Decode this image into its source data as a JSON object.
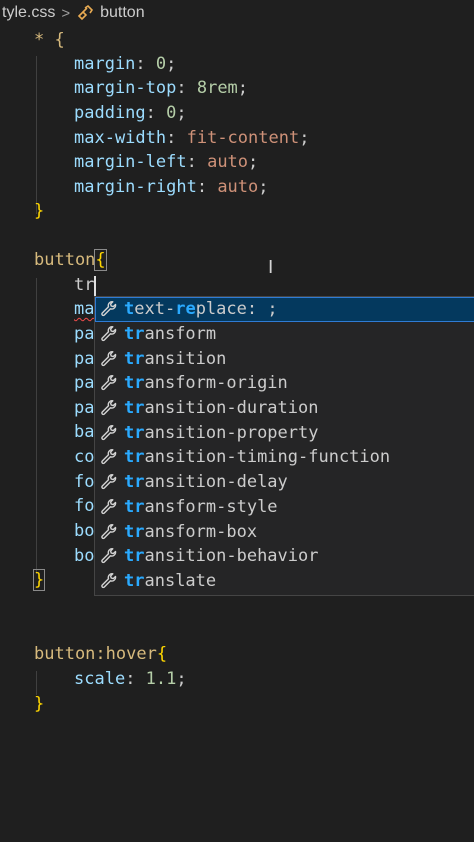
{
  "breadcrumb": {
    "file": "tyle.css",
    "separator": ">",
    "symbol": "button"
  },
  "code": {
    "l1": {
      "sel": "* {"
    },
    "l2": {
      "prop": "margin",
      "colon": ": ",
      "val": "0",
      "semi": ";"
    },
    "l3": {
      "prop": "margin-top",
      "colon": ": ",
      "val": "8rem",
      "semi": ";"
    },
    "l4": {
      "prop": "padding",
      "colon": ": ",
      "val": "0",
      "semi": ";"
    },
    "l5": {
      "prop": "max-width",
      "colon": ": ",
      "val": "fit-content",
      "semi": ";"
    },
    "l6": {
      "prop": "margin-left",
      "colon": ": ",
      "val": "auto",
      "semi": ";"
    },
    "l7": {
      "prop": "margin-right",
      "colon": ": ",
      "val": "auto",
      "semi": ";"
    },
    "l8": {
      "close": "}"
    },
    "l10": {
      "sel": "button",
      "open": "{"
    },
    "l11": {
      "typed": "tr"
    },
    "l12": {
      "frag": "ma"
    },
    "l13": {
      "frag": "pa"
    },
    "l14": {
      "frag": "pa"
    },
    "l15": {
      "frag": "pa"
    },
    "l16": {
      "frag": "pa"
    },
    "l17": {
      "frag": "ba"
    },
    "l18": {
      "frag": "co"
    },
    "l19": {
      "frag": "fo"
    },
    "l20": {
      "frag": "fo"
    },
    "l21": {
      "frag": "bo"
    },
    "l22": {
      "frag": "bo"
    },
    "l23": {
      "close": "}"
    },
    "l26": {
      "sel": "button:hover",
      "open": "{"
    },
    "l27": {
      "prop": "scale",
      "colon": ": ",
      "val": "1.1",
      "semi": ";"
    },
    "l28": {
      "close": "}"
    }
  },
  "suggestions": [
    {
      "match": "t",
      "gap": "ext-",
      "match2": "re",
      "rest": "place: ;"
    },
    {
      "match": "tr",
      "rest": "ansform"
    },
    {
      "match": "tr",
      "rest": "ansition"
    },
    {
      "match": "tr",
      "rest": "ansform-origin"
    },
    {
      "match": "tr",
      "rest": "ansition-duration"
    },
    {
      "match": "tr",
      "rest": "ansition-property"
    },
    {
      "match": "tr",
      "rest": "ansition-timing-function"
    },
    {
      "match": "tr",
      "rest": "ansition-delay"
    },
    {
      "match": "tr",
      "rest": "ansform-style"
    },
    {
      "match": "tr",
      "rest": "ansform-box"
    },
    {
      "match": "tr",
      "rest": "ansition-behavior"
    },
    {
      "match": "tr",
      "rest": "anslate"
    }
  ],
  "colors": {
    "background": "#1f1f1f",
    "accent": "#2aaaff",
    "selection": "#04395e"
  }
}
